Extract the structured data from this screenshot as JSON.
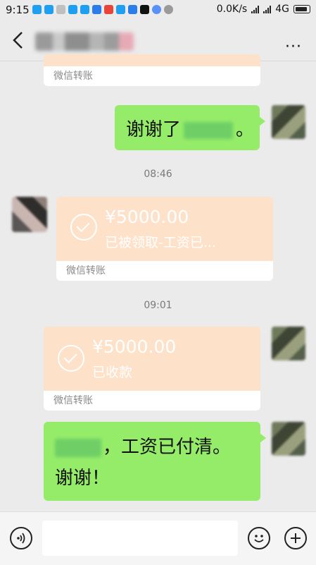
{
  "status_bar": {
    "time": "9:15",
    "network_speed": "0.0K/s",
    "network_type": "4G"
  },
  "header": {
    "back_icon": "chevron-left-icon",
    "more_label": "···"
  },
  "messages": {
    "transfer_top_footer": "微信转账",
    "thanks_prefix": "谢谢了",
    "thanks_suffix": "。",
    "time_1": "08:46",
    "transfer_received": {
      "amount": "¥5000.00",
      "status": "已被领取-工资已...",
      "footer": "微信转账"
    },
    "time_2": "09:01",
    "transfer_sent": {
      "amount": "¥5000.00",
      "status": "已收款",
      "footer": "微信转账"
    },
    "salary_line1": "，工资已付清。",
    "salary_line2": "谢谢！"
  },
  "input_bar": {
    "voice_icon": "voice-icon",
    "emoji_icon": "emoji-icon",
    "plus_icon": "plus-icon"
  },
  "colors": {
    "bubble_green": "#95ec69",
    "transfer_orange": "#fde1c9",
    "background": "#ebebeb"
  }
}
